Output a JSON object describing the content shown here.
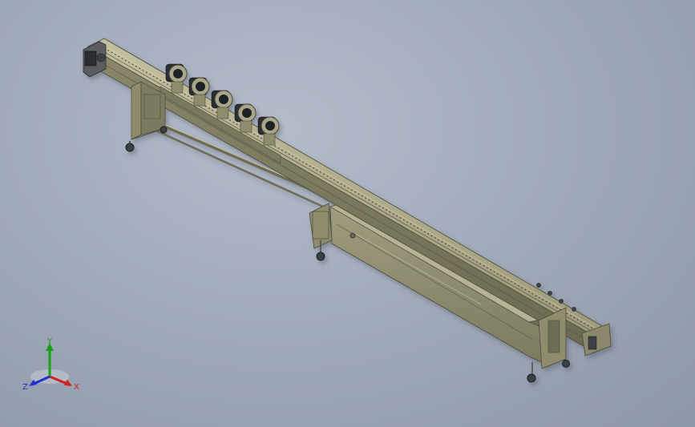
{
  "viewport": {
    "background_top": "#b4bcca",
    "background_bottom": "#8e97a7"
  },
  "model": {
    "description_colors": {
      "frame": "#8f8c6e",
      "frame_dark": "#5f5d47",
      "frame_light": "#b3b08f",
      "motor": "#3b3f46",
      "roller": "#1f2226"
    },
    "roller_count": 5
  },
  "triad": {
    "x_label": "X",
    "y_label": "Y",
    "z_label": "Z",
    "x_color": "#d22020",
    "y_color": "#18a018",
    "z_color": "#2030d0"
  }
}
